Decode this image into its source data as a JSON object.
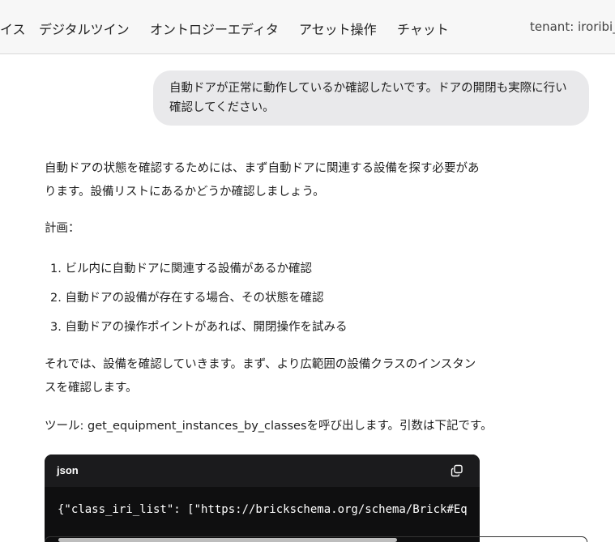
{
  "nav": {
    "items": [
      "イス",
      "デジタルツイン",
      "オントロジーエディタ",
      "アセット操作",
      "チャット"
    ],
    "tenant": "tenant: iroribi_t"
  },
  "chat": {
    "user_message": "自動ドアが正常に動作しているか確認したいです。ドアの開閉も実際に行い確認してください。",
    "assistant": {
      "p1": "自動ドアの状態を確認するためには、まず自動ドアに関連する設備を探す必要があります。設備リストにあるかどうか確認しましょう。",
      "p2": "計画：",
      "plan": [
        "1. ビル内に自動ドアに関連する設備があるか確認",
        "2. 自動ドアの設備が存在する場合、その状態を確認",
        "3. 自動ドアの操作ポイントがあれば、開閉操作を試みる"
      ],
      "p3": "それでは、設備を確認していきます。まず、より広範囲の設備クラスのインスタンスを確認します。",
      "p4": "ツール: get_equipment_instances_by_classesを呼び出します。引数は下記です。"
    },
    "code": {
      "lang": "json",
      "line": "{\"class_iri_list\": [\"https://brickschema.org/schema/Brick#Eq"
    }
  }
}
